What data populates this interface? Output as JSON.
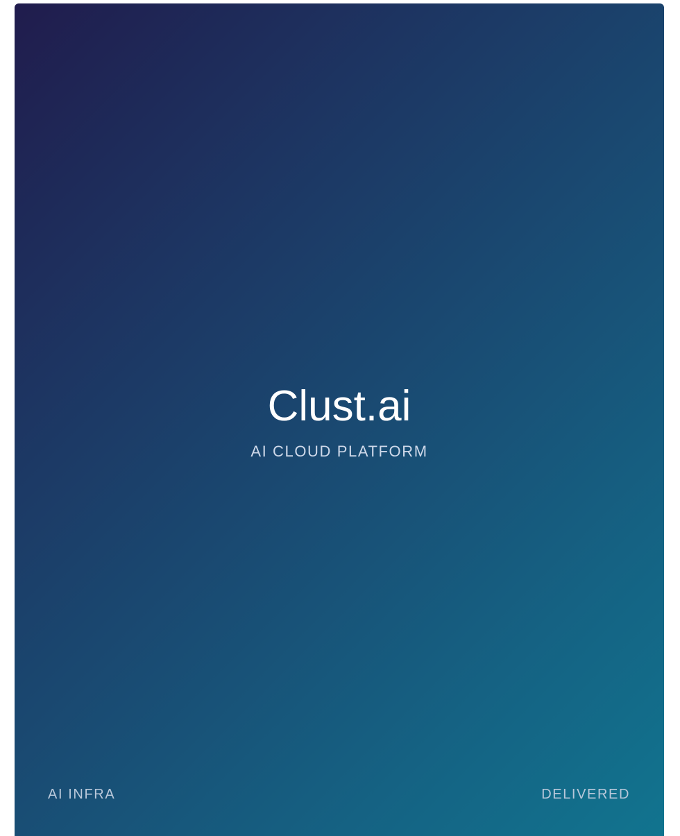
{
  "hero": {
    "title": "Clust.ai",
    "subtitle": "AI CLOUD PLATFORM"
  },
  "footer": {
    "left_label": "AI INFRA",
    "right_label": "DELIVERED"
  },
  "colors": {
    "gradient_start": "#201c4d",
    "gradient_end": "#11748f",
    "title_text": "#ffffff",
    "subtitle_text": "#cfd9ea",
    "footer_text": "#b9c8da"
  }
}
